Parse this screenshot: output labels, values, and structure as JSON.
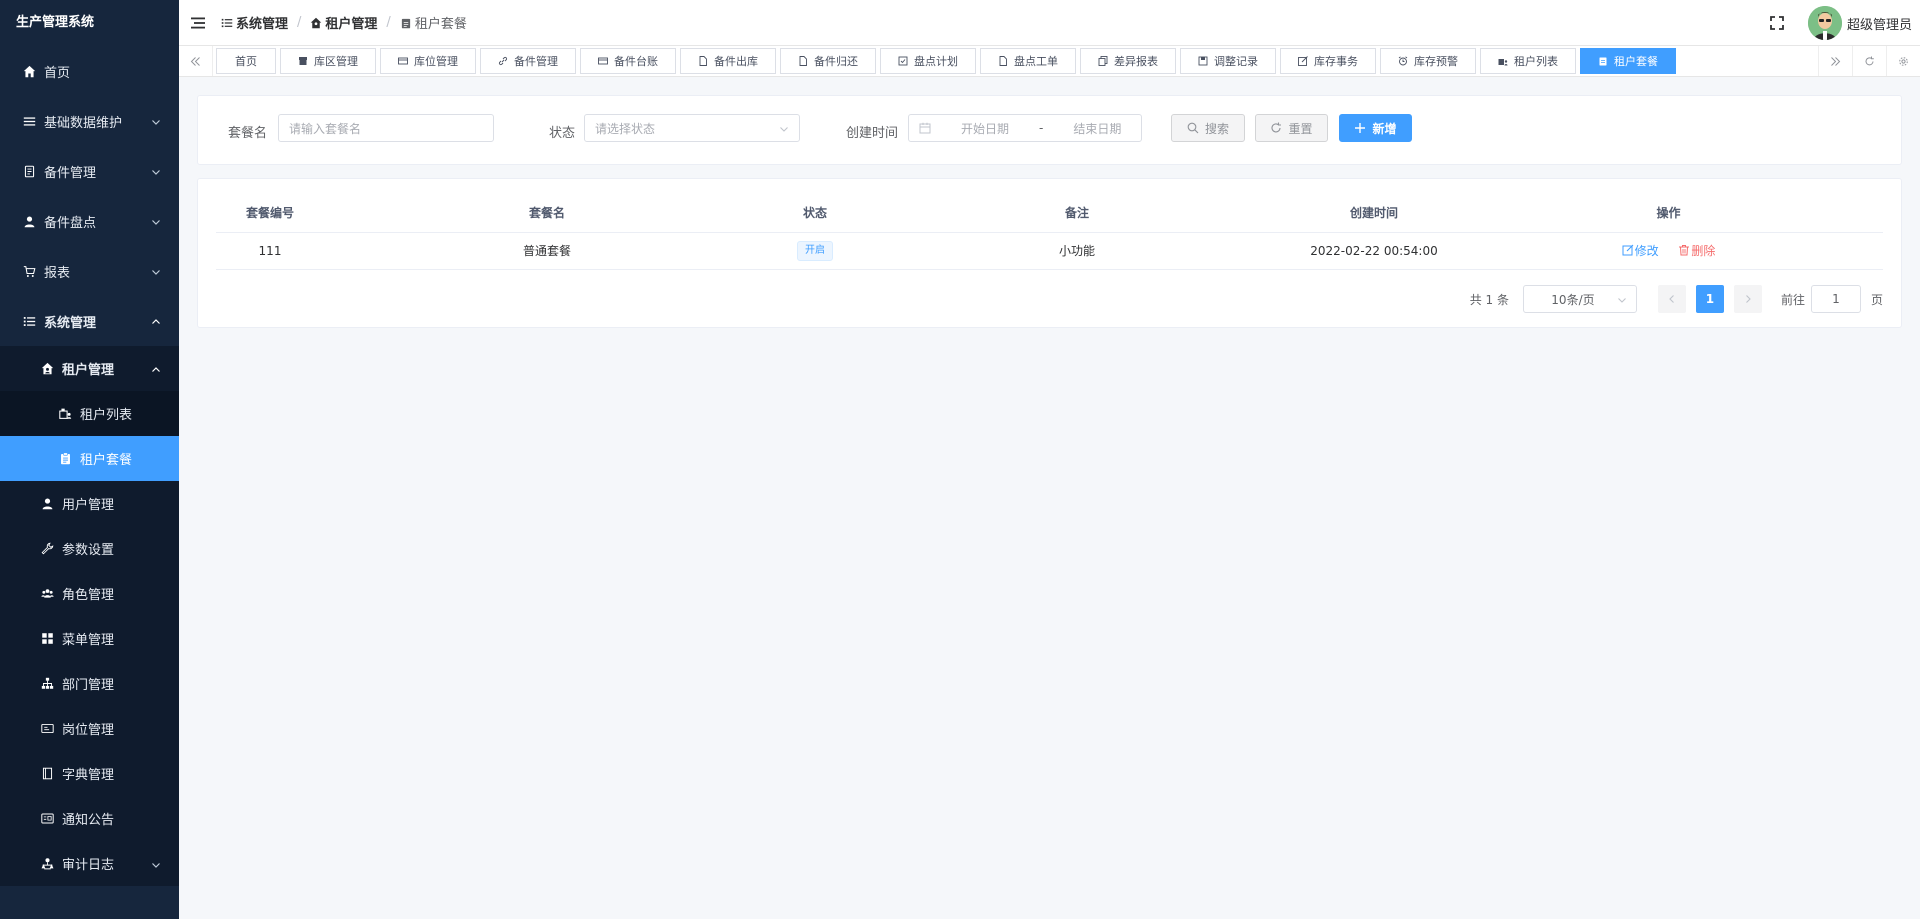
{
  "app": {
    "title": "生产管理系统"
  },
  "sidebar": {
    "items": [
      {
        "label": "首页"
      },
      {
        "label": "基础数据维护"
      },
      {
        "label": "备件管理"
      },
      {
        "label": "备件盘点"
      },
      {
        "label": "报表"
      },
      {
        "label": "系统管理"
      },
      {
        "label": "租户管理"
      },
      {
        "label": "租户列表"
      },
      {
        "label": "租户套餐"
      },
      {
        "label": "用户管理"
      },
      {
        "label": "参数设置"
      },
      {
        "label": "角色管理"
      },
      {
        "label": "菜单管理"
      },
      {
        "label": "部门管理"
      },
      {
        "label": "岗位管理"
      },
      {
        "label": "字典管理"
      },
      {
        "label": "通知公告"
      },
      {
        "label": "审计日志"
      }
    ]
  },
  "breadcrumb": {
    "items": [
      "系统管理",
      "租户管理",
      "租户套餐"
    ]
  },
  "user": {
    "name": "超级管理员"
  },
  "tags": {
    "items": [
      "首页",
      "库区管理",
      "库位管理",
      "备件管理",
      "备件台账",
      "备件出库",
      "备件归还",
      "盘点计划",
      "盘点工单",
      "差异报表",
      "调整记录",
      "库存事务",
      "库存预警",
      "租户列表",
      "租户套餐"
    ]
  },
  "search": {
    "name_label": "套餐名",
    "name_placeholder": "请输入套餐名",
    "status_label": "状态",
    "status_placeholder": "请选择状态",
    "time_label": "创建时间",
    "start_placeholder": "开始日期",
    "range_sep": "-",
    "end_placeholder": "结束日期",
    "search_btn": "搜索",
    "reset_btn": "重置",
    "add_btn": "新增"
  },
  "table": {
    "columns": [
      "套餐编号",
      "套餐名",
      "状态",
      "备注",
      "创建时间",
      "操作"
    ],
    "rows": [
      {
        "id": "111",
        "name": "普通套餐",
        "status": "开启",
        "remark": "小功能",
        "created": "2022-02-22 00:54:00",
        "edit": "修改",
        "delete": "删除"
      }
    ]
  },
  "pagination": {
    "total": "共 1 条",
    "page_size": "10条/页",
    "current": "1",
    "goto_label": "前往",
    "goto_value": "1",
    "page_unit": "页"
  },
  "colors": {
    "sidebar_bg": "#16263d",
    "accent": "#409eff",
    "danger": "#f56c6c"
  }
}
